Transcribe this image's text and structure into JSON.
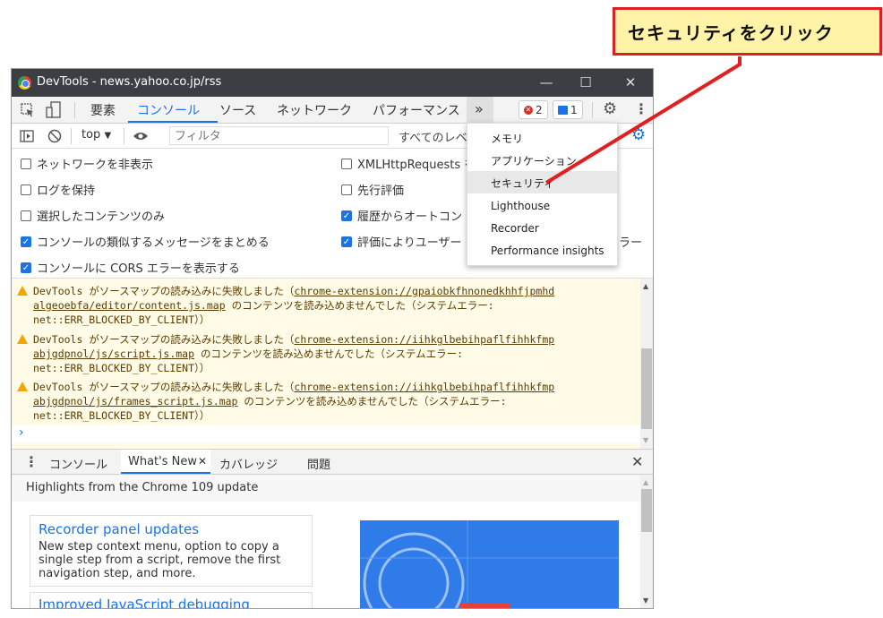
{
  "callout": {
    "text": "セキュリティをクリック",
    "border_color": "#e02020",
    "bg_color": "#fff3a8"
  },
  "window": {
    "title": "DevTools - news.yahoo.co.jp/rss",
    "controls": {
      "minimize": "—",
      "maximize": "☐",
      "close": "✕"
    }
  },
  "toolbar": {
    "tabs": [
      "要素",
      "コンソール",
      "ソース",
      "ネットワーク",
      "パフォーマンス"
    ],
    "active_tab": "コンソール",
    "more": "»",
    "error_count": "2",
    "message_count": "1"
  },
  "filterbar": {
    "context": "top",
    "filter_placeholder": "フィルタ",
    "levels": "すべてのレベル"
  },
  "options_left": [
    {
      "label": "ネットワークを非表示",
      "checked": false
    },
    {
      "label": "ログを保持",
      "checked": false
    },
    {
      "label": "選択したコンテンツのみ",
      "checked": false
    },
    {
      "label": "コンソールの類似するメッセージをまとめる",
      "checked": true
    },
    {
      "label": "コンソールに CORS エラーを表示する",
      "checked": true
    }
  ],
  "options_right": [
    {
      "label": "XMLHttpRequests を",
      "checked": false
    },
    {
      "label": "先行評価",
      "checked": false
    },
    {
      "label": "履歴からオートコン",
      "checked": true
    },
    {
      "label": "評価によりユーザー",
      "checked": true
    }
  ],
  "options_right_tail": "ラー",
  "messages": [
    {
      "line1_pre": "DevTools がソースマップの読み込みに失敗しました（",
      "line1_link": "chrome-extension://gpaiobkfhnonedkhhfjpmhd",
      "line2_link": "algeoebfa/editor/content.js.map",
      "line2_post": " のコンテンツを読み込めませんでした（システムエラー:",
      "line3": "net::ERR_BLOCKED_BY_CLIENT））"
    },
    {
      "line1_pre": "DevTools がソースマップの読み込みに失敗しました（",
      "line1_link": "chrome-extension://iihkglbebihpaflfihhkfmp",
      "line2_link": "abjgdpnol/js/script.js.map",
      "line2_post": " のコンテンツを読み込めませんでした（システムエラー:",
      "line3": "net::ERR_BLOCKED_BY_CLIENT））"
    },
    {
      "line1_pre": "DevTools がソースマップの読み込みに失敗しました（",
      "line1_link": "chrome-extension://iihkglbebihpaflfihhkfmp",
      "line2_link": "abjgdpnol/js/frames_script.js.map",
      "line2_post": " のコンテンツを読み込めませんでした（システムエラー:",
      "line3": "net::ERR_BLOCKED_BY_CLIENT））"
    }
  ],
  "prompt": "›",
  "drawer": {
    "tabs": [
      "コンソール",
      "What's New",
      "カバレッジ",
      "問題"
    ],
    "active_tab": "What's New",
    "close": "✕"
  },
  "whats_new": {
    "highlights": "Highlights from the Chrome 109 update",
    "card1_title": "Recorder panel updates",
    "card1_body": "New step context menu, option to copy a single step from a script, remove the first navigation step, and more.",
    "card2_title": "Improved JavaScript debugging"
  },
  "menu": {
    "items": [
      "メモリ",
      "アプリケーション",
      "セキュリティ",
      "Lighthouse",
      "Recorder",
      "Performance insights"
    ],
    "highlighted": "セキュリティ"
  },
  "accent_color": "#1a73e8"
}
